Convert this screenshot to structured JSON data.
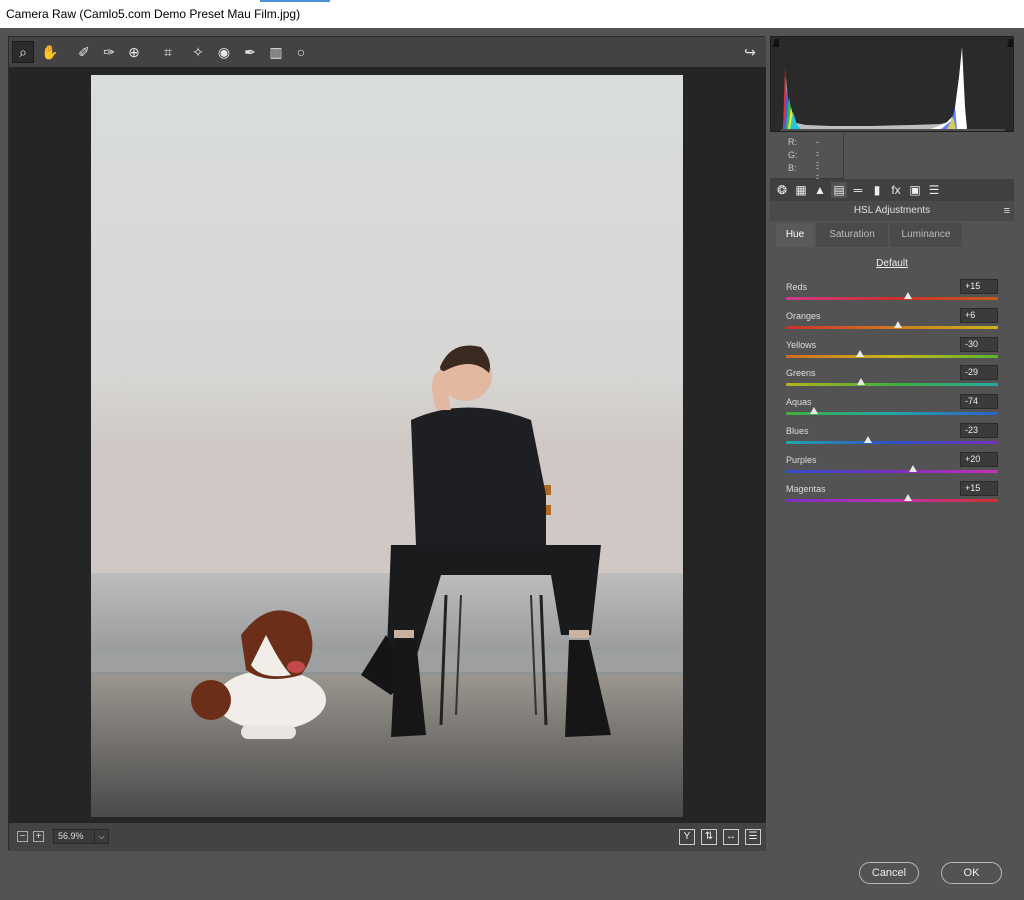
{
  "window": {
    "title": "Camera Raw (Camlo5.com Demo Preset Mau Film.jpg)"
  },
  "toolbar": {
    "tools": [
      {
        "name": "zoom-tool",
        "glyph": "⌕",
        "selected": true
      },
      {
        "name": "hand-tool",
        "glyph": "✋",
        "selected": false
      },
      {
        "name": "white-balance-tool",
        "glyph": "✐",
        "selected": false
      },
      {
        "name": "color-sampler-tool",
        "glyph": "✑",
        "selected": false
      },
      {
        "name": "targeted-adjustment-tool",
        "glyph": "⊕",
        "selected": false
      },
      {
        "name": "crop-tool",
        "glyph": "⌗",
        "selected": false
      },
      {
        "name": "spot-removal-tool",
        "glyph": "✧",
        "selected": false
      },
      {
        "name": "red-eye-tool",
        "glyph": "◉",
        "selected": false
      },
      {
        "name": "adjustment-brush-tool",
        "glyph": "✒",
        "selected": false
      },
      {
        "name": "graduated-filter-tool",
        "glyph": "▥",
        "selected": false
      },
      {
        "name": "radial-filter-tool",
        "glyph": "○",
        "selected": false
      }
    ],
    "open_preferences_glyph": "↪"
  },
  "bottom": {
    "zoom_out": "−",
    "zoom_in": "+",
    "zoom_value": "56.9%",
    "dropdown": "⌵",
    "view_icons": [
      "Y",
      "⇅",
      "↔",
      "☰"
    ]
  },
  "readout": {
    "r_label": "R:",
    "r_value": "---",
    "g_label": "G:",
    "g_value": "---",
    "b_label": "B:",
    "b_value": "---"
  },
  "panel_icons": [
    "❂",
    "▦",
    "▲",
    "▤",
    "═",
    "▮",
    "fx",
    "▣",
    "☰"
  ],
  "panel": {
    "title": "HSL Adjustments",
    "menu_glyph": "≡",
    "tabs": [
      "Hue",
      "Saturation",
      "Luminance"
    ],
    "default_link": "Default",
    "sliders": [
      {
        "label": "Reds",
        "value": "+15",
        "level": 15,
        "gradient": "linear-gradient(90deg,#d03a8f,#c9302c,#c95a18)"
      },
      {
        "label": "Oranges",
        "value": "+6",
        "level": 6,
        "gradient": "linear-gradient(90deg,#c9302c,#d2781f,#c9b31c)"
      },
      {
        "label": "Yellows",
        "value": "-30",
        "level": -30,
        "gradient": "linear-gradient(90deg,#d26a1f,#c9b81c,#5ab52e)"
      },
      {
        "label": "Greens",
        "value": "-29",
        "level": -29,
        "gradient": "linear-gradient(90deg,#b8b21c,#3fb03a,#23a8a2)"
      },
      {
        "label": "Aquas",
        "value": "-74",
        "level": -74,
        "gradient": "linear-gradient(90deg,#3fb03a,#22a7a7,#2e5fcc)"
      },
      {
        "label": "Blues",
        "value": "-23",
        "level": -23,
        "gradient": "linear-gradient(90deg,#22a7a7,#2d50c8,#7a2fc3)"
      },
      {
        "label": "Purples",
        "value": "+20",
        "level": 20,
        "gradient": "linear-gradient(90deg,#2d50c8,#7a2fc3,#c72fb3)"
      },
      {
        "label": "Magentas",
        "value": "+15",
        "level": 15,
        "gradient": "linear-gradient(90deg,#7a2fc3,#c72fb3,#d0302c)"
      }
    ]
  },
  "buttons": {
    "cancel": "Cancel",
    "ok": "OK"
  }
}
